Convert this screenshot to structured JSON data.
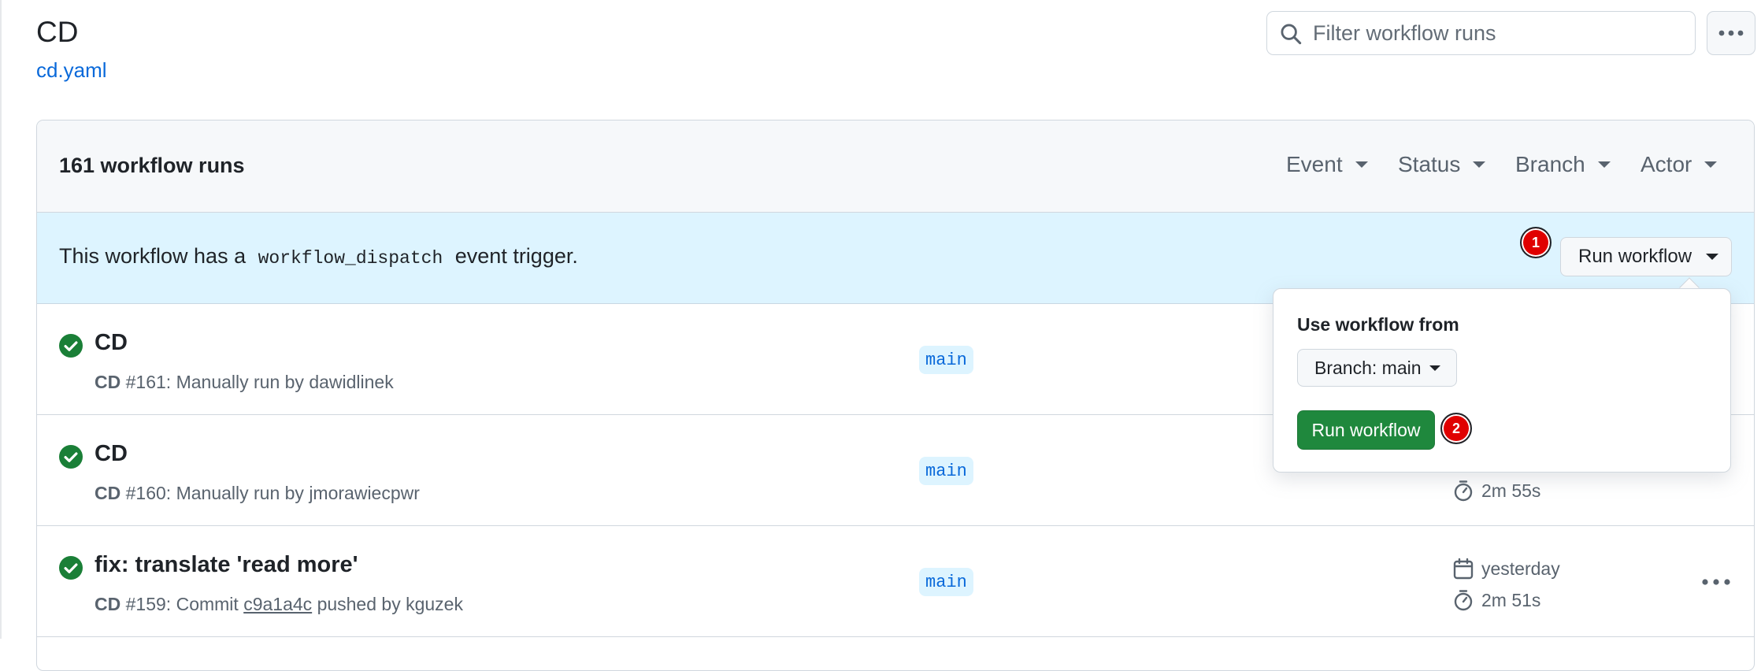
{
  "header": {
    "title": "CD",
    "file_link": "cd.yaml",
    "filter_placeholder": "Filter workflow runs"
  },
  "runs_list": {
    "count_label": "161 workflow runs",
    "filters": [
      "Event",
      "Status",
      "Branch",
      "Actor"
    ]
  },
  "dispatch_banner": {
    "text_before": "This workflow has a",
    "code": "workflow_dispatch",
    "text_after": "event trigger.",
    "run_button_label": "Run workflow"
  },
  "popover": {
    "heading": "Use workflow from",
    "branch_select_label": "Branch: main",
    "submit_label": "Run workflow"
  },
  "annotations": {
    "badge_1": "1",
    "badge_2": "2"
  },
  "runs": [
    {
      "title": "CD",
      "workflow": "CD",
      "run_number": "#161",
      "description": "Manually run by dawidlinek",
      "branch": "main"
    },
    {
      "title": "CD",
      "workflow": "CD",
      "run_number": "#160",
      "description": "Manually run by jmorawiecpwr",
      "branch": "main",
      "duration": "2m 55s"
    },
    {
      "title": "fix: translate 'read more'",
      "workflow": "CD",
      "run_number": "#159",
      "description_prefix": "Commit",
      "commit_sha": "c9a1a4c",
      "description_suffix": "pushed by kguzek",
      "branch": "main",
      "date": "yesterday",
      "duration": "2m 51s"
    }
  ],
  "colors": {
    "accent_link": "#0969da",
    "success": "#1a7f37",
    "primary_button": "#1f883d",
    "banner_bg": "#ddf4ff",
    "badge": "#e00000"
  },
  "icons": {
    "search": "search-icon",
    "more": "kebab-horizontal-icon",
    "success": "check-circle-fill-icon",
    "calendar": "calendar-icon",
    "stopwatch": "stopwatch-icon"
  }
}
